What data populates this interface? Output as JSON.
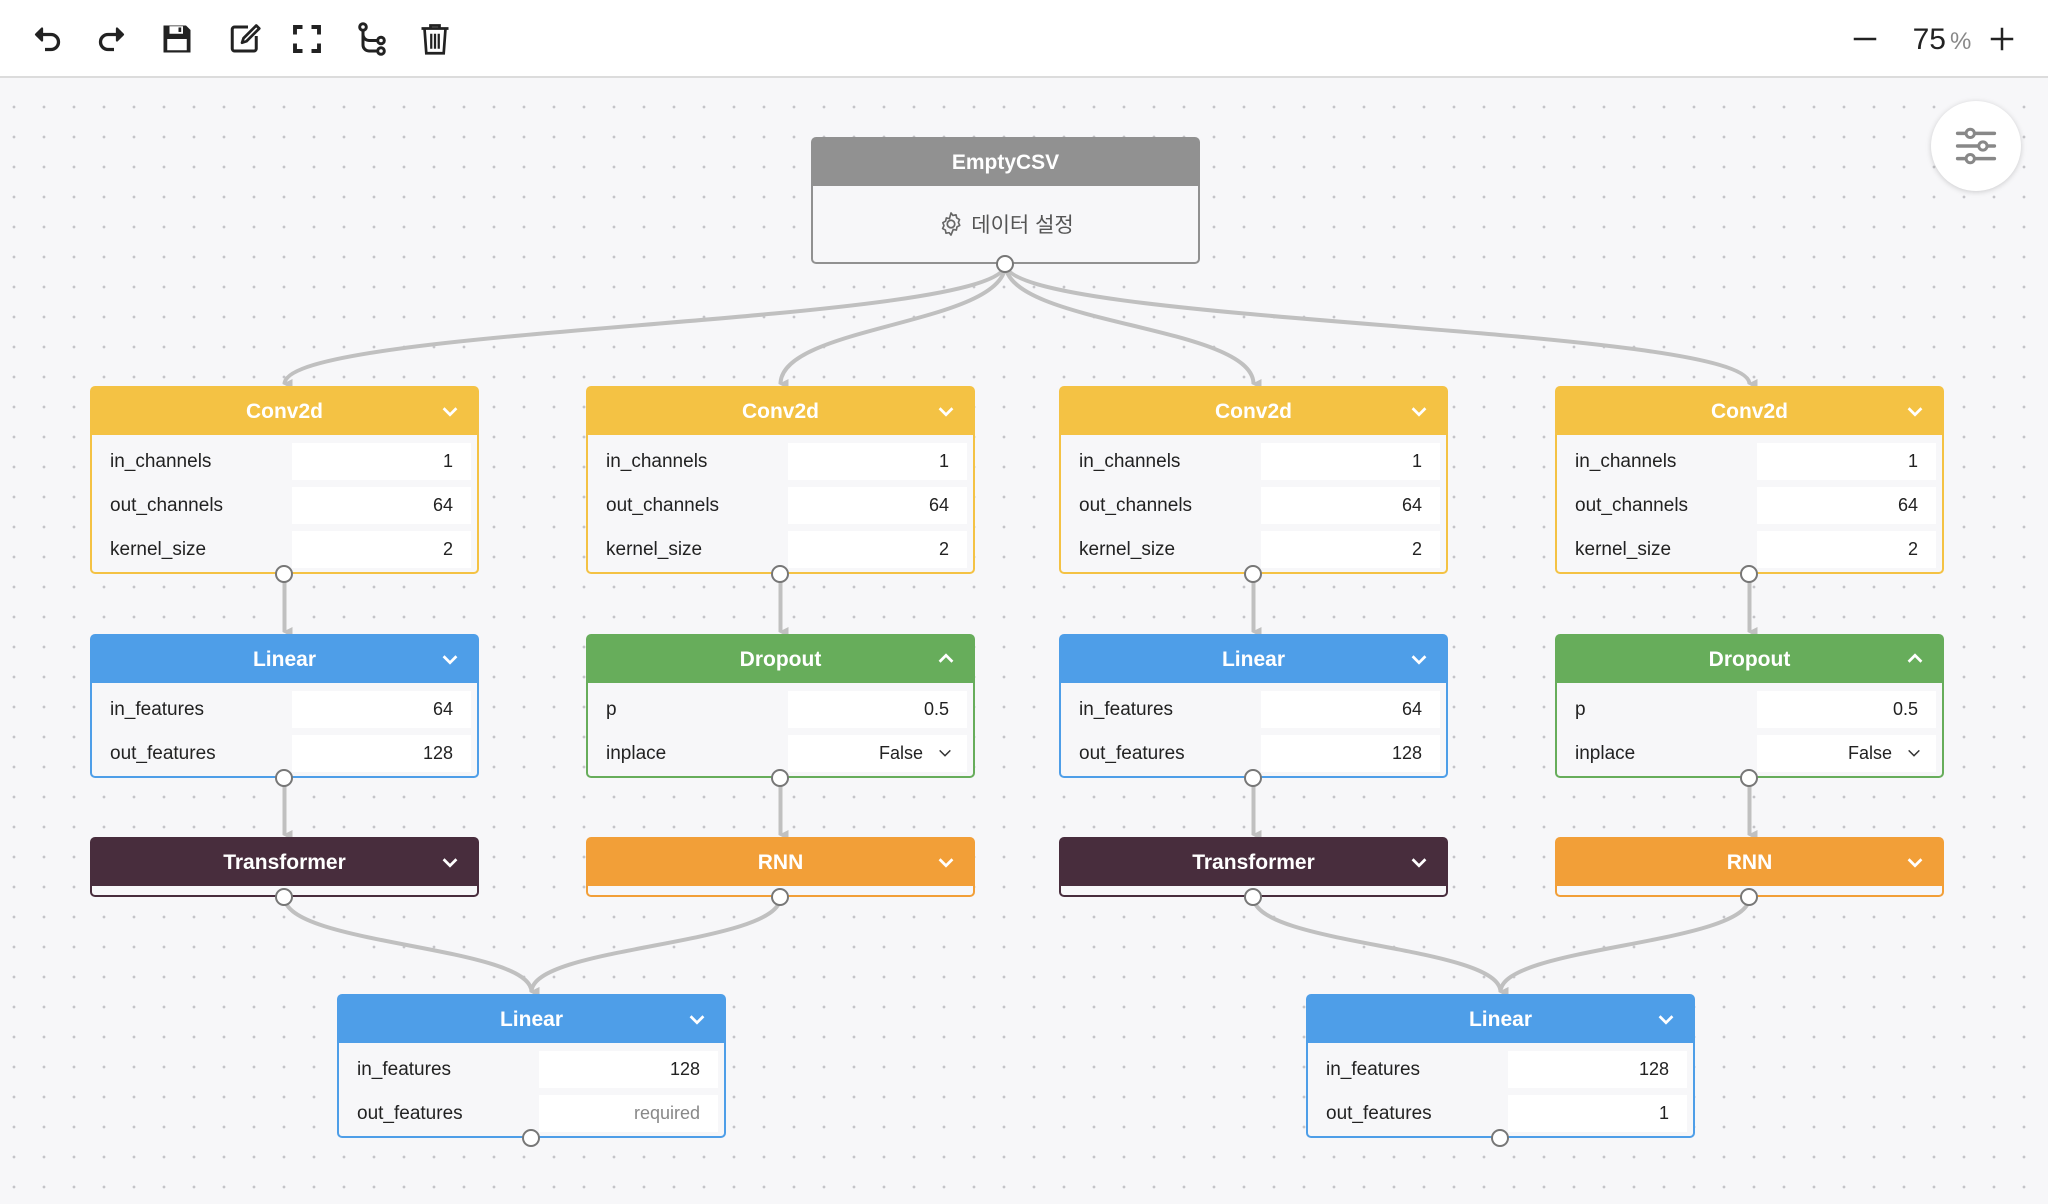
{
  "toolbar": {
    "icons": [
      "undo-icon",
      "redo-icon",
      "save-icon",
      "edit-icon",
      "fullscreen-icon",
      "flow-branch-icon",
      "trash-icon"
    ],
    "zoom": {
      "value": "75",
      "unit": "%",
      "minus": "−",
      "plus": "+"
    }
  },
  "colors": {
    "conv2d": "#f4c244",
    "linear": "#4e9ee8",
    "dropout": "#67ad5b",
    "transformer": "#482d3d",
    "rnn": "#f29f38",
    "source": "#919191",
    "edge": "#c0c0c0"
  },
  "source_node": {
    "title": "EmptyCSV",
    "action_label": "데이터 설정",
    "action_icon": "gear-icon"
  },
  "nodes": {
    "conv1": {
      "title": "Conv2d",
      "params": [
        {
          "label": "in_channels",
          "value": "1"
        },
        {
          "label": "out_channels",
          "value": "64"
        },
        {
          "label": "kernel_size",
          "value": "2"
        }
      ]
    },
    "conv2": {
      "title": "Conv2d",
      "params": [
        {
          "label": "in_channels",
          "value": "1"
        },
        {
          "label": "out_channels",
          "value": "64"
        },
        {
          "label": "kernel_size",
          "value": "2"
        }
      ]
    },
    "conv3": {
      "title": "Conv2d",
      "params": [
        {
          "label": "in_channels",
          "value": "1"
        },
        {
          "label": "out_channels",
          "value": "64"
        },
        {
          "label": "kernel_size",
          "value": "2"
        }
      ]
    },
    "conv4": {
      "title": "Conv2d",
      "params": [
        {
          "label": "in_channels",
          "value": "1"
        },
        {
          "label": "out_channels",
          "value": "64"
        },
        {
          "label": "kernel_size",
          "value": "2"
        }
      ]
    },
    "linear1": {
      "title": "Linear",
      "params": [
        {
          "label": "in_features",
          "value": "64"
        },
        {
          "label": "out_features",
          "value": "128"
        }
      ]
    },
    "dropout2": {
      "title": "Dropout",
      "params": [
        {
          "label": "p",
          "value": "0.5"
        },
        {
          "label": "inplace",
          "value": "False"
        }
      ]
    },
    "linear3": {
      "title": "Linear",
      "params": [
        {
          "label": "in_features",
          "value": "64"
        },
        {
          "label": "out_features",
          "value": "128"
        }
      ]
    },
    "dropout4": {
      "title": "Dropout",
      "params": [
        {
          "label": "p",
          "value": "0.5"
        },
        {
          "label": "inplace",
          "value": "False"
        }
      ]
    },
    "transformer1": {
      "title": "Transformer"
    },
    "rnn2": {
      "title": "RNN"
    },
    "transformer3": {
      "title": "Transformer"
    },
    "rnn4": {
      "title": "RNN"
    },
    "linearA": {
      "title": "Linear",
      "params": [
        {
          "label": "in_features",
          "value": "128"
        },
        {
          "label": "out_features",
          "value": "",
          "placeholder": "required"
        }
      ]
    },
    "linearB": {
      "title": "Linear",
      "params": [
        {
          "label": "in_features",
          "value": "128"
        },
        {
          "label": "out_features",
          "value": "1"
        }
      ]
    }
  }
}
